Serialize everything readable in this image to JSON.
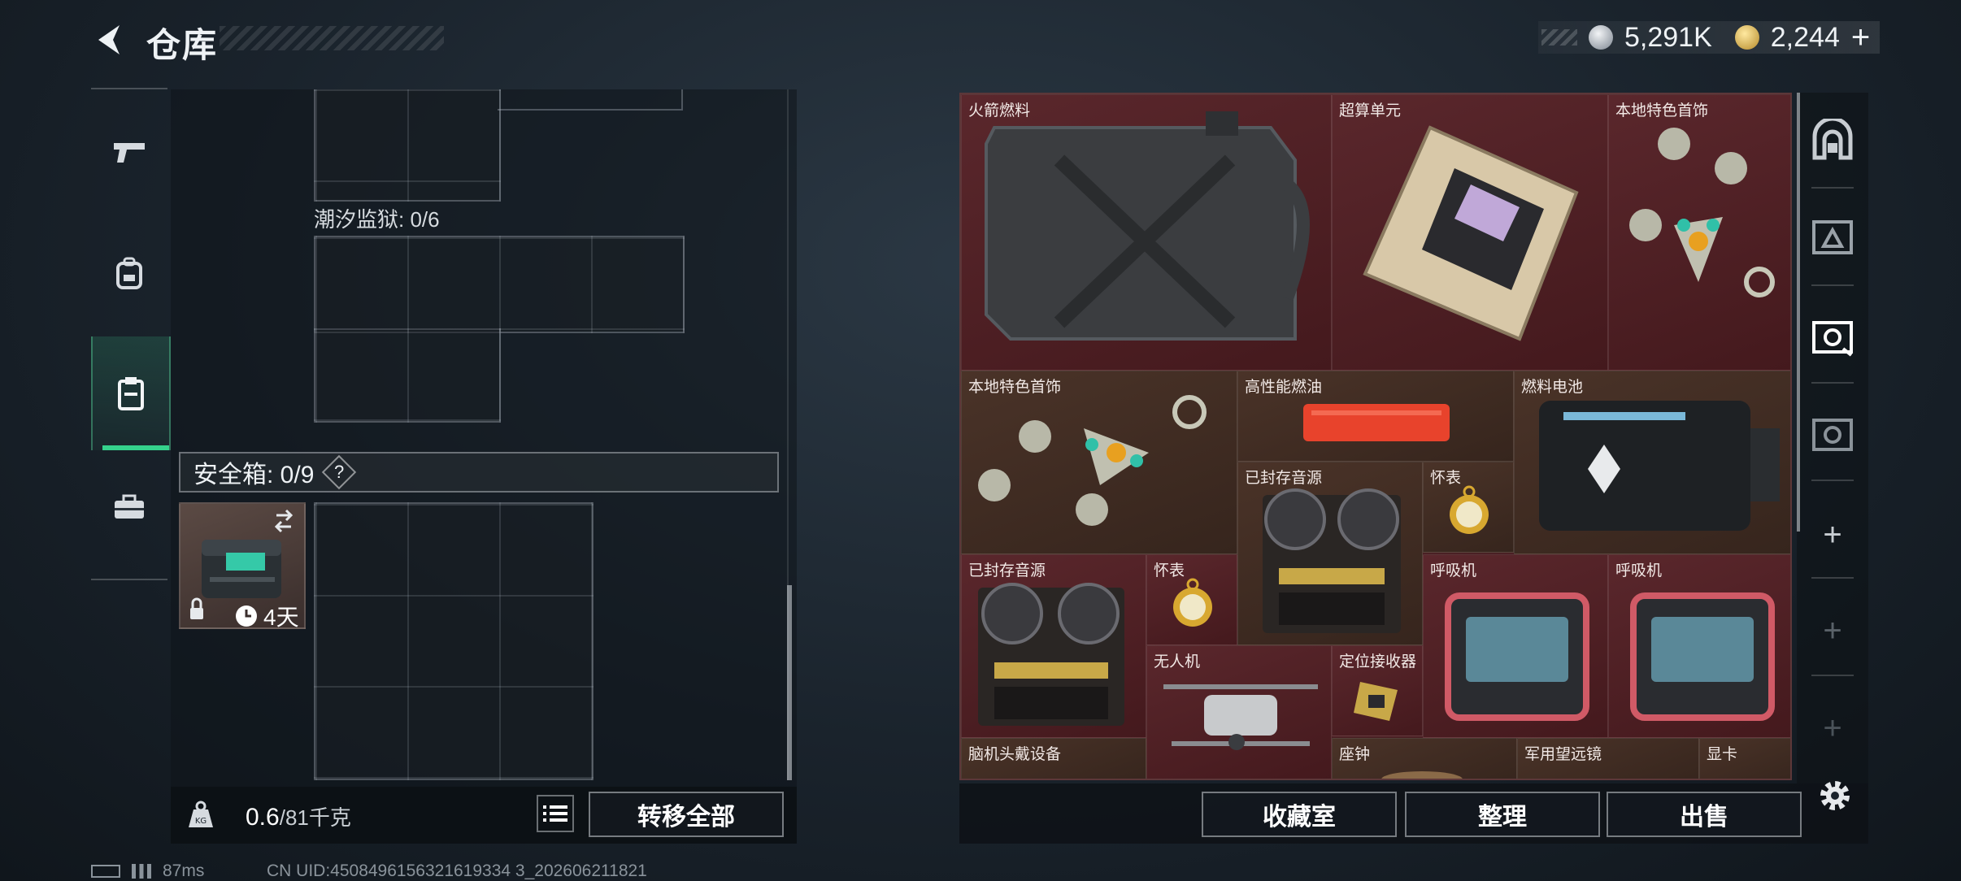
{
  "header": {
    "title": "仓库",
    "currency": [
      {
        "icon": "silver-coin-icon",
        "value": "5,291K"
      },
      {
        "icon": "gold-coin-icon",
        "value": "2,244"
      }
    ],
    "add_symbol": "+"
  },
  "left_nav": {
    "items": [
      {
        "icon": "pistol-icon"
      },
      {
        "icon": "backpack-icon"
      },
      {
        "icon": "clipboard-icon",
        "active": true
      },
      {
        "icon": "briefcase-icon"
      }
    ]
  },
  "inventory": {
    "section_label": "潮汐监狱: 0/6",
    "safebox": {
      "label": "安全箱: 0/9",
      "help": "?"
    },
    "safecase_timer": "4天"
  },
  "footer_left": {
    "weight_current": "0.6",
    "weight_max": "/81千克",
    "transfer_all": "转移全部"
  },
  "storage_items": [
    {
      "label": "火箭燃料",
      "icon": "jerrycan-icon"
    },
    {
      "label": "超算单元",
      "icon": "circuit-board-icon"
    },
    {
      "label": "本地特色首饰",
      "icon": "jewelry-icon"
    },
    {
      "label": "本地特色首饰",
      "icon": "jewelry-icon"
    },
    {
      "label": "高性能燃油",
      "icon": "fuel-box-icon"
    },
    {
      "label": "燃料电池",
      "icon": "battery-icon"
    },
    {
      "label": "已封存音源",
      "icon": "tape-recorder-icon"
    },
    {
      "label": "怀表",
      "icon": "pocket-watch-icon"
    },
    {
      "label": "已封存音源",
      "icon": "tape-recorder-icon"
    },
    {
      "label": "怀表",
      "icon": "pocket-watch-icon"
    },
    {
      "label": "呼吸机",
      "icon": "ventilator-icon"
    },
    {
      "label": "呼吸机",
      "icon": "ventilator-icon"
    },
    {
      "label": "无人机",
      "icon": "drone-icon"
    },
    {
      "label": "定位接收器",
      "icon": "receiver-icon"
    },
    {
      "label": "脑机头戴设备",
      "icon": "headset-icon"
    },
    {
      "label": "座钟",
      "icon": "clock-icon"
    },
    {
      "label": "军用望远镜",
      "icon": "binoculars-icon"
    },
    {
      "label": "显卡",
      "icon": "gpu-icon"
    }
  ],
  "footer_right": {
    "collection": "收藏室",
    "sort": "整理",
    "sell": "出售"
  },
  "right_nav": {
    "add_symbol": "+"
  },
  "status_bar": {
    "ping": "87ms",
    "uid": "CN UID:4508496156321619334 3_202606211821"
  },
  "colors": {
    "accent": "#35d28c",
    "storage_bg": "#4a2024"
  }
}
